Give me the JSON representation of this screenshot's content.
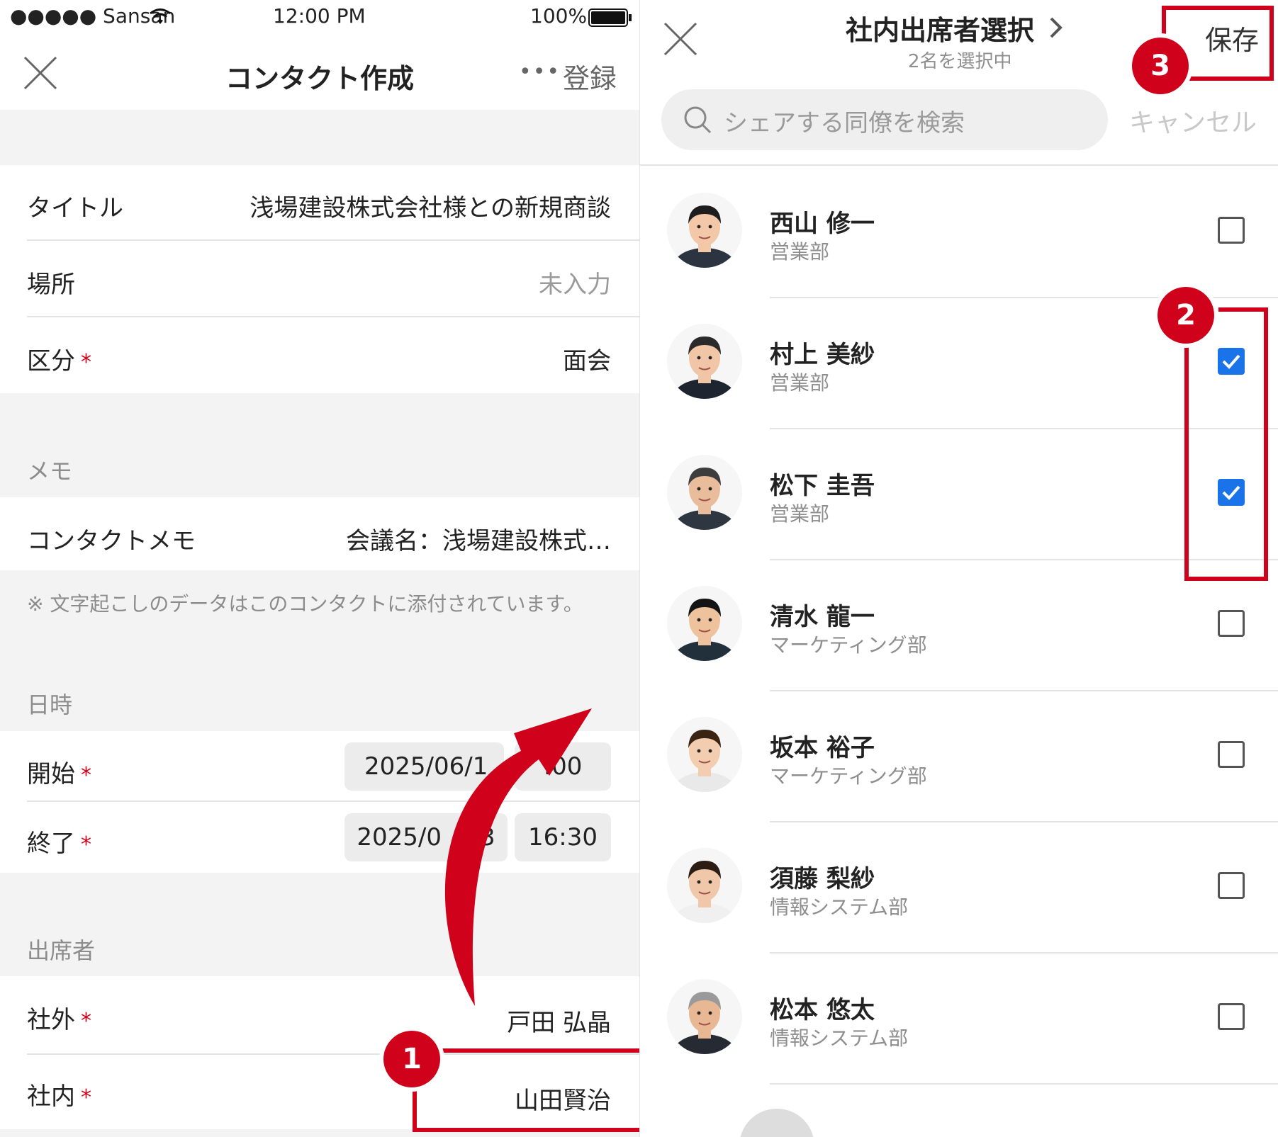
{
  "status_bar": {
    "carrier": "●●●●● Sansan",
    "time": "12:00 PM",
    "battery": "100%"
  },
  "left": {
    "header": {
      "title": "コンタクト作成",
      "more": "•••",
      "register": "登録"
    },
    "fields": {
      "title_label": "タイトル",
      "title_value": "浅場建設株式会社様との新規商談",
      "place_label": "場所",
      "place_value": "未入力",
      "category_label": "区分",
      "category_value": "面会"
    },
    "memo_section": "メモ",
    "memo": {
      "label": "コンタクトメモ",
      "value": "会議名：浅場建設株式…",
      "note": "※ 文字起こしのデータはこのコンタクトに添付されています。"
    },
    "datetime_section": "日時",
    "start": {
      "label": "開始",
      "date": "2025/06/1",
      "time": ":00"
    },
    "end": {
      "label": "終了",
      "date": "2025/0   13",
      "time": "16:30"
    },
    "attendees_section": "出席者",
    "external": {
      "label": "社外",
      "value": "戸田 弘晶"
    },
    "internal": {
      "label": "社内",
      "value": "山田賢治"
    },
    "required_mark": "*"
  },
  "right": {
    "header": {
      "title": "社内出席者選択",
      "subtitle": "2名を選択中",
      "save": "保存"
    },
    "search": {
      "placeholder": "シェアする同僚を検索",
      "cancel": "キャンセル"
    },
    "people": [
      {
        "name": "西山 修一",
        "dept": "営業部",
        "checked": false
      },
      {
        "name": "村上 美紗",
        "dept": "営業部",
        "checked": true
      },
      {
        "name": "松下 圭吾",
        "dept": "営業部",
        "checked": true
      },
      {
        "name": "清水 龍一",
        "dept": "マーケティング部",
        "checked": false
      },
      {
        "name": "坂本 裕子",
        "dept": "マーケティング部",
        "checked": false
      },
      {
        "name": "須藤 梨紗",
        "dept": "情報システム部",
        "checked": false
      },
      {
        "name": "松本 悠太",
        "dept": "情報システム部",
        "checked": false
      }
    ]
  },
  "annotations": {
    "step1": "1",
    "step2": "2",
    "step3": "3"
  },
  "colors": {
    "accent_red": "#d0021b",
    "check_blue": "#1a73e8"
  }
}
